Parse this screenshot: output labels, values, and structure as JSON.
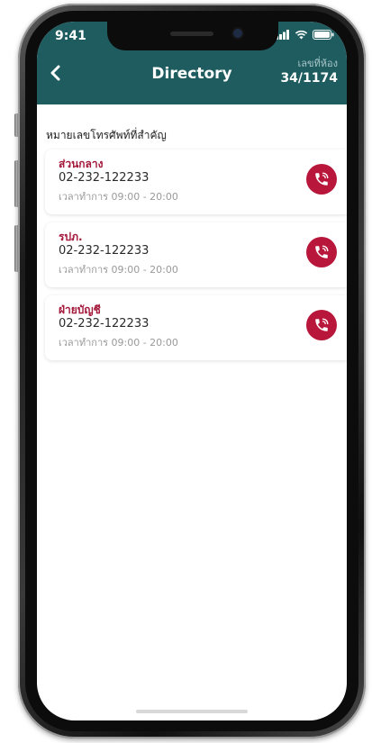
{
  "status_bar": {
    "time": "9:41",
    "icons": [
      "signal-icon",
      "wifi-icon",
      "battery-icon"
    ]
  },
  "header": {
    "back_icon": "chevron-left-icon",
    "title": "Directory",
    "room_label": "เลขที่ห้อง",
    "room_number": "34/1174"
  },
  "section": {
    "heading": "หมายเลขโทรศัพท์ที่สำคัญ"
  },
  "contacts": [
    {
      "name": "ส่วนกลาง",
      "phone": "02-232-122233",
      "hours": "เวลาทำการ 09:00 - 20:00",
      "icon": "phone-call-icon"
    },
    {
      "name": "รปภ.",
      "phone": "02-232-122233",
      "hours": "เวลาทำการ 09:00 - 20:00",
      "icon": "phone-call-icon"
    },
    {
      "name": "ฝ่ายบัญชี",
      "phone": "02-232-122233",
      "hours": "เวลาทำการ 09:00 - 20:00",
      "icon": "phone-call-icon"
    }
  ],
  "colors": {
    "header_bg": "#1f5c60",
    "accent": "#b8173b",
    "contact_name": "#a3173a"
  }
}
